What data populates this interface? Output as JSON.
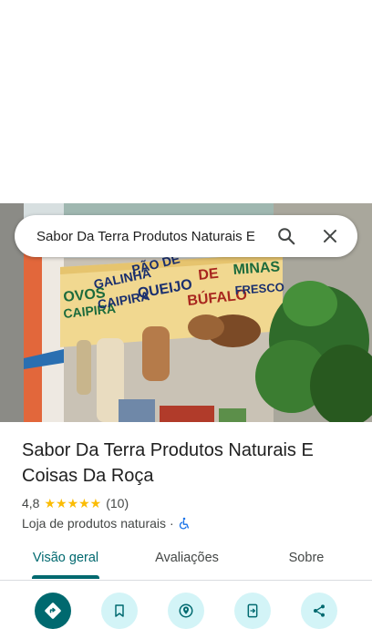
{
  "search": {
    "query": "Sabor Da Terra Produtos Naturais E"
  },
  "place": {
    "title": "Sabor Da Terra Produtos Naturais E Coisas Da Roça",
    "rating": "4,8",
    "stars": "★★★★★",
    "review_count": "(10)",
    "category": "Loja de produtos naturais",
    "separator": "·",
    "accessibility_icon": "wheelchair-icon"
  },
  "tabs": [
    {
      "label": "Visão geral",
      "active": true
    },
    {
      "label": "Avaliações",
      "active": false
    },
    {
      "label": "Sobre",
      "active": false
    }
  ],
  "photo_signs": {
    "sign_1_line_1": "OVOS",
    "sign_1_line_2": "CAIPIRA",
    "sign_2_line_1": "GALINHA",
    "sign_2_line_2": "CAIPIRA",
    "sign_3_line_1": "PÃO DE",
    "sign_3_line_2": "QUEIJO",
    "sign_4_line_1": "DE",
    "sign_4_line_2": "BÚFALO",
    "sign_5_line_1": "MINAS",
    "sign_5_line_2": "FRESCO"
  },
  "actions": [
    {
      "icon": "directions-icon"
    },
    {
      "icon": "bookmark-icon"
    },
    {
      "icon": "nearby-icon"
    },
    {
      "icon": "send-to-phone-icon"
    },
    {
      "icon": "share-icon"
    }
  ],
  "colors": {
    "accent": "#00696f",
    "accent_light": "#d3f4f7",
    "star": "#fbbc04",
    "text_secondary": "#444746"
  }
}
